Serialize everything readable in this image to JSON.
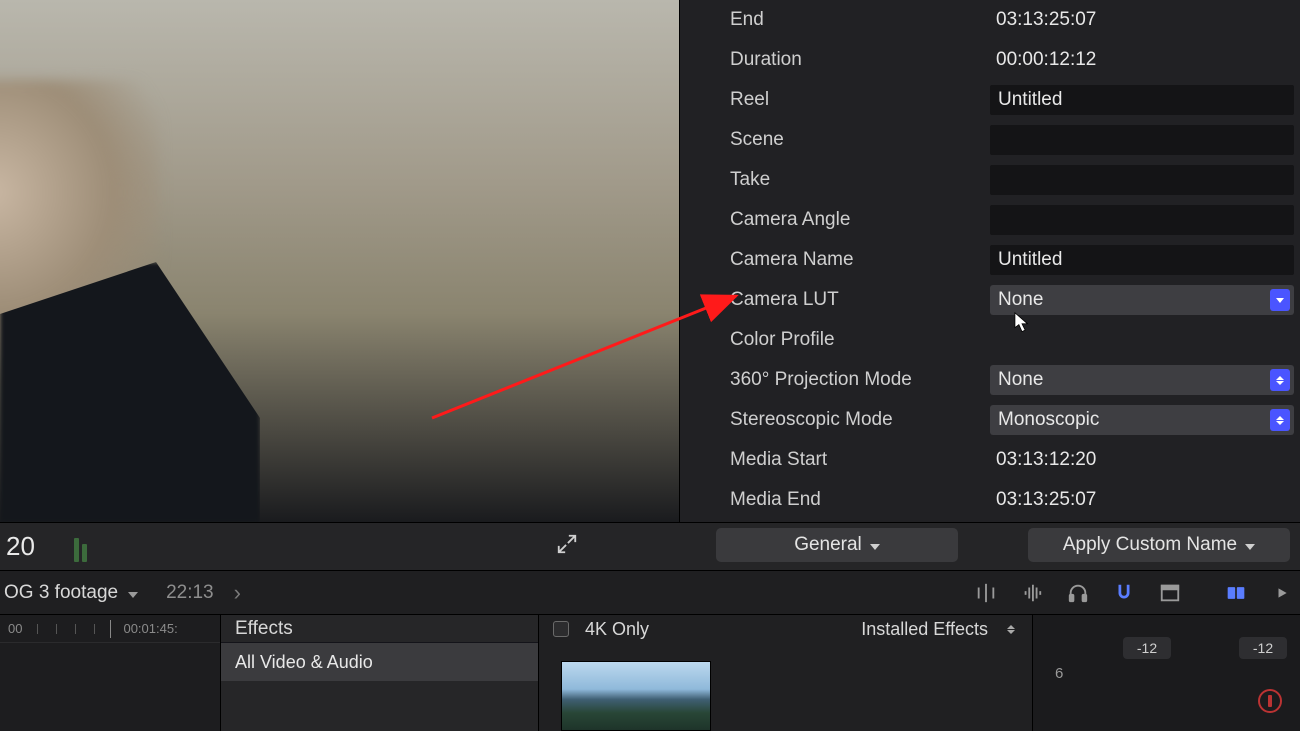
{
  "inspector": {
    "end": {
      "label": "End",
      "value": "03:13:25:07"
    },
    "duration": {
      "label": "Duration",
      "value": "00:00:12:12"
    },
    "reel": {
      "label": "Reel",
      "value": "Untitled"
    },
    "scene": {
      "label": "Scene",
      "value": ""
    },
    "take": {
      "label": "Take",
      "value": ""
    },
    "cameraAngle": {
      "label": "Camera Angle",
      "value": ""
    },
    "cameraName": {
      "label": "Camera Name",
      "value": "Untitled"
    },
    "cameraLUT": {
      "label": "Camera LUT",
      "value": "None"
    },
    "colorProfile": {
      "label": "Color Profile",
      "value": ""
    },
    "projectionMode": {
      "label": "360° Projection Mode",
      "value": "None"
    },
    "stereoMode": {
      "label": "Stereoscopic Mode",
      "value": "Monoscopic"
    },
    "mediaStart": {
      "label": "Media Start",
      "value": "03:13:12:20"
    },
    "mediaEnd": {
      "label": "Media End",
      "value": "03:13:25:07"
    }
  },
  "midbar": {
    "tcFragment": "20",
    "generalBtn": "General",
    "customNameBtn": "Apply Custom Name"
  },
  "crumb": {
    "projectName": "OG 3 footage",
    "duration": "22:13"
  },
  "timeline": {
    "tick1": "00",
    "tick2": "00:01:45:"
  },
  "effects": {
    "header": "Effects",
    "category": "All Video & Audio"
  },
  "browser": {
    "filterLabel": "4K Only",
    "scopeLabel": "Installed Effects"
  },
  "audio": {
    "db1": "-12",
    "db2": "-12",
    "scale": "6"
  }
}
